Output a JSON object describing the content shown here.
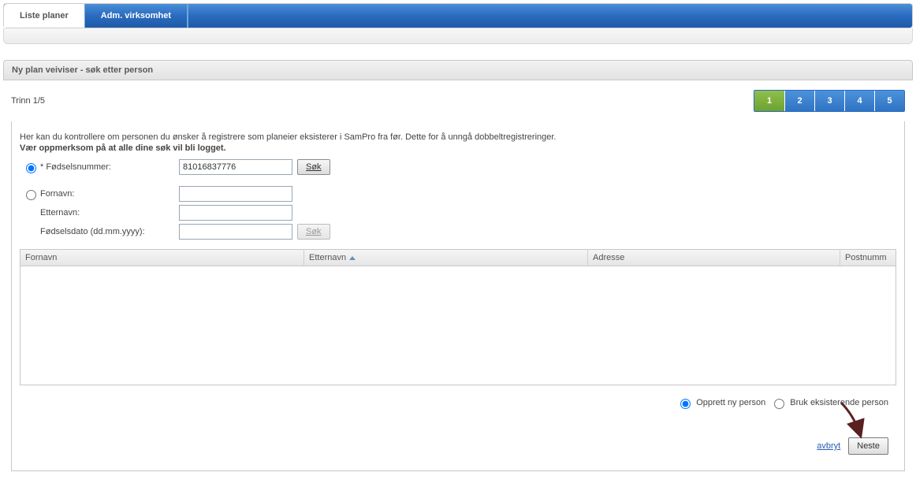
{
  "tabs": {
    "liste_planer": "Liste planer",
    "adm_virksomhet": "Adm. virksomhet"
  },
  "panel": {
    "title": "Ny plan veiviser - søk etter person"
  },
  "wizard": {
    "step_text": "Trinn 1/5",
    "steps": [
      "1",
      "2",
      "3",
      "4",
      "5"
    ]
  },
  "intro": {
    "line1": "Her kan du kontrollere om personen du ønsker å registrere som planeier eksisterer i SamPro fra før. Dette for å unngå dobbeltregistreringer.",
    "line2_bold": "Vær oppmerksom på at alle dine søk vil bli logget."
  },
  "form": {
    "fodselsnummer_label": "* Fødselsnummer:",
    "fodselsnummer_value": "81016837776",
    "sok": "Søk",
    "fornavn_label": "Fornavn:",
    "etternavn_label": "Etternavn:",
    "fodselsdato_label": "Fødselsdato (dd.mm.yyyy):"
  },
  "table": {
    "col_fornavn": "Fornavn",
    "col_etternavn": "Etternavn",
    "col_adresse": "Adresse",
    "col_postnummer": "Postnumm"
  },
  "options": {
    "opprett": "Opprett ny person",
    "bruk": "Bruk eksisterende person"
  },
  "footer": {
    "avbryt": "avbryt",
    "neste": "Neste"
  }
}
